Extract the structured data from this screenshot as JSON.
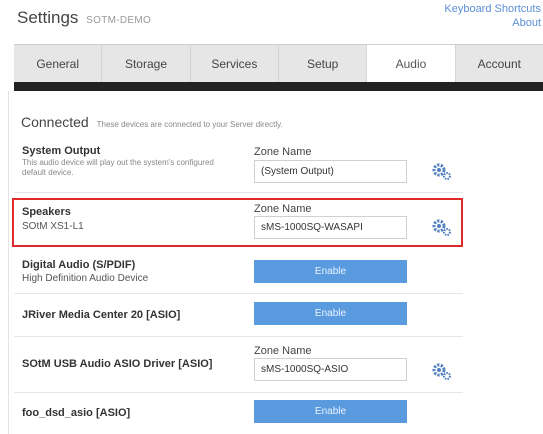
{
  "header": {
    "title": "Settings",
    "subtitle": "SOTM-DEMO",
    "links": [
      "Keyboard Shortcuts",
      "About"
    ]
  },
  "tabs": [
    {
      "label": "General",
      "active": false
    },
    {
      "label": "Storage",
      "active": false
    },
    {
      "label": "Services",
      "active": false
    },
    {
      "label": "Setup",
      "active": false
    },
    {
      "label": "Audio",
      "active": true
    },
    {
      "label": "Account",
      "active": false
    }
  ],
  "section": {
    "title": "Connected",
    "description": "These devices are connected to your Server directly."
  },
  "devices": [
    {
      "name": "System Output",
      "description": "This audio device will play out the system's configured default device.",
      "zone_label": "Zone Name",
      "zone_value": "(System Output)",
      "icon": "gear-icon"
    },
    {
      "name": "Speakers",
      "subtitle": "SOtM XS1-L1",
      "zone_label": "Zone Name",
      "zone_value": "sMS-1000SQ-WASAPI",
      "icon": "gear-icon",
      "highlighted": true
    },
    {
      "name": "Digital Audio (S/PDIF)",
      "subtitle": "High Definition Audio Device",
      "button": "Enable"
    },
    {
      "name": "JRiver Media Center 20 [ASIO]",
      "button": "Enable"
    },
    {
      "name": "SOtM USB Audio ASIO Driver [ASIO]",
      "zone_label": "Zone Name",
      "zone_value": "sMS-1000SQ-ASIO",
      "icon": "gear-icon"
    },
    {
      "name": "foo_dsd_asio [ASIO]",
      "button": "Enable"
    }
  ],
  "colors": {
    "accent": "#5a9be0",
    "link": "#5b8fd6",
    "highlight": "#e02a2a",
    "tab_bar_dark": "#222222",
    "gear": "#4f7fc0"
  }
}
